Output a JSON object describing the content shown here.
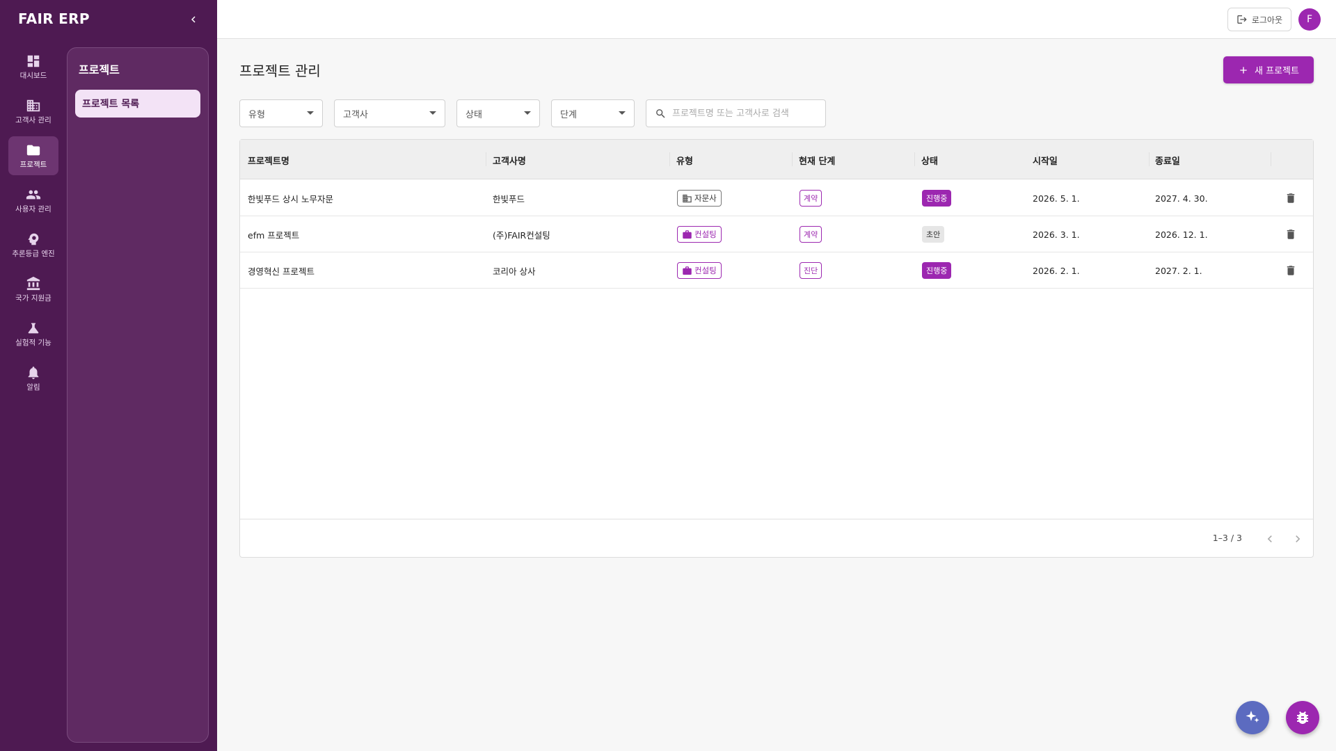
{
  "app": {
    "brand": "FAIR ERP"
  },
  "nav": {
    "items": [
      {
        "label": "대시보드",
        "icon": "dashboard-icon"
      },
      {
        "label": "고객사 관리",
        "icon": "building-icon"
      },
      {
        "label": "프로젝트",
        "icon": "folder-icon",
        "active": true
      },
      {
        "label": "사용자 관리",
        "icon": "people-icon"
      },
      {
        "label": "추론등급 엔진",
        "icon": "psychology-icon"
      },
      {
        "label": "국가 지원금",
        "icon": "bank-icon"
      },
      {
        "label": "실험적 기능",
        "icon": "flask-icon"
      },
      {
        "label": "알림",
        "icon": "bell-icon"
      }
    ]
  },
  "subnav": {
    "title": "프로젝트",
    "items": [
      {
        "label": "프로젝트 목록"
      }
    ]
  },
  "topbar": {
    "logout_label": "로그아웃",
    "avatar_initial": "F"
  },
  "page": {
    "title": "프로젝트 관리",
    "new_button_label": "새 프로젝트"
  },
  "filters": {
    "type": "유형",
    "client": "고객사",
    "status": "상태",
    "stage": "단계",
    "search_placeholder": "프로젝트명 또는 고객사로 검색"
  },
  "table": {
    "columns": [
      "프로젝트명",
      "고객사명",
      "유형",
      "현재 단계",
      "상태",
      "시작일",
      "종료일"
    ],
    "rows": [
      {
        "name": "한빛푸드 상시 노무자문",
        "client": "한빛푸드",
        "type": "자문사",
        "type_icon": "building-icon",
        "stage": "계약",
        "status": "진행중",
        "status_kind": "active",
        "start": "2026. 5. 1.",
        "end": "2027. 4. 30."
      },
      {
        "name": "efm 프로젝트",
        "client": "(주)FAIR컨설팅",
        "type": "컨설팅",
        "type_icon": "briefcase-icon",
        "stage": "계약",
        "status": "초안",
        "status_kind": "draft",
        "start": "2026. 3. 1.",
        "end": "2026. 12. 1."
      },
      {
        "name": "경영혁신 프로젝트",
        "client": "코리아 상사",
        "type": "컨설팅",
        "type_icon": "briefcase-icon",
        "stage": "진단",
        "status": "진행중",
        "status_kind": "active",
        "start": "2026. 2. 1.",
        "end": "2027. 2. 1."
      }
    ]
  },
  "pagination": {
    "text": "1–3 / 3"
  },
  "colors": {
    "sidebar": "#4e1a52",
    "accent": "#9c27b0",
    "ai_fab": "#5c6bc0"
  }
}
